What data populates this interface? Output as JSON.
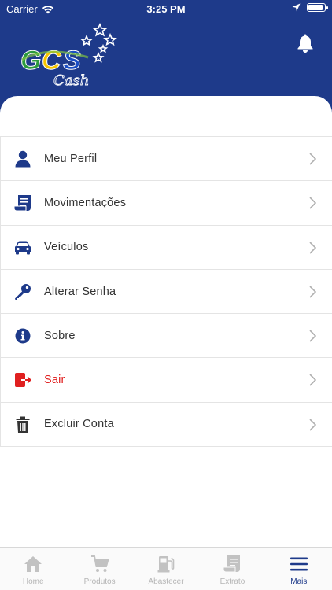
{
  "status_bar": {
    "carrier": "Carrier",
    "time": "3:25 PM"
  },
  "header": {
    "logo_text": "GCS Cash"
  },
  "menu": {
    "items": [
      {
        "label": "Meu Perfil",
        "icon": "user-icon"
      },
      {
        "label": "Movimentações",
        "icon": "receipt-icon"
      },
      {
        "label": "Veículos",
        "icon": "car-icon"
      },
      {
        "label": "Alterar Senha",
        "icon": "key-icon"
      },
      {
        "label": "Sobre",
        "icon": "info-icon"
      },
      {
        "label": "Sair",
        "icon": "logout-icon"
      },
      {
        "label": "Excluir Conta",
        "icon": "trash-icon"
      }
    ]
  },
  "tabs": [
    {
      "label": "Home",
      "icon": "home-icon",
      "active": false
    },
    {
      "label": "Produtos",
      "icon": "cart-icon",
      "active": false
    },
    {
      "label": "Abastecer",
      "icon": "fuel-pump-icon",
      "active": false
    },
    {
      "label": "Extrato",
      "icon": "statement-icon",
      "active": false
    },
    {
      "label": "Mais",
      "icon": "menu-icon",
      "active": true
    }
  ],
  "colors": {
    "primary": "#1e3a8a",
    "danger": "#e02020",
    "inactive": "#b5b5b5"
  }
}
